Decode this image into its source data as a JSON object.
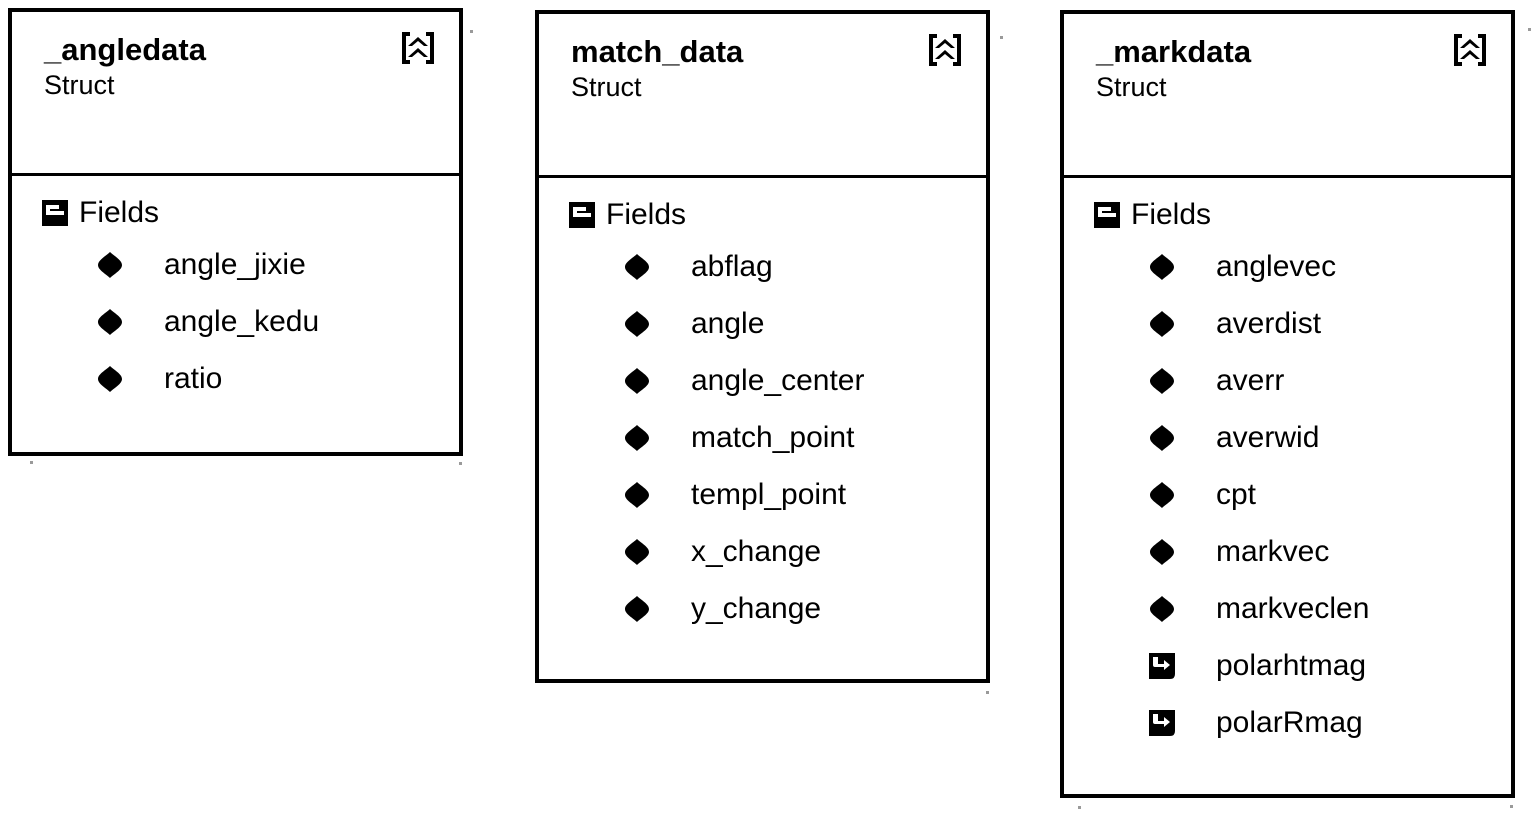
{
  "diagram": {
    "kind": "uml-struct-diagram",
    "background_color": "#ffffff",
    "line_color": "#000000",
    "cards": [
      {
        "title": "_angledata",
        "stereotype": "Struct",
        "collapse_icon": "double-chevron-up-icon",
        "group": {
          "label": "Fields",
          "icon": "fields-group-icon"
        },
        "fields": [
          {
            "name": "angle_jixie",
            "icon": "field-diamond-icon"
          },
          {
            "name": "angle_kedu",
            "icon": "field-diamond-icon"
          },
          {
            "name": "ratio",
            "icon": "field-diamond-icon"
          }
        ]
      },
      {
        "title": "match_data",
        "stereotype": "Struct",
        "collapse_icon": "double-chevron-up-icon",
        "group": {
          "label": "Fields",
          "icon": "fields-group-icon"
        },
        "fields": [
          {
            "name": "abflag",
            "icon": "field-diamond-icon"
          },
          {
            "name": "angle",
            "icon": "field-diamond-icon"
          },
          {
            "name": "angle_center",
            "icon": "field-diamond-icon"
          },
          {
            "name": "match_point",
            "icon": "field-diamond-icon"
          },
          {
            "name": "templ_point",
            "icon": "field-diamond-icon"
          },
          {
            "name": "x_change",
            "icon": "field-diamond-icon"
          },
          {
            "name": "y_change",
            "icon": "field-diamond-icon"
          }
        ]
      },
      {
        "title": "_markdata",
        "stereotype": "Struct",
        "collapse_icon": "double-chevron-up-icon",
        "group": {
          "label": "Fields",
          "icon": "fields-group-icon"
        },
        "fields": [
          {
            "name": "anglevec",
            "icon": "field-diamond-icon"
          },
          {
            "name": "averdist",
            "icon": "field-diamond-icon"
          },
          {
            "name": "averr",
            "icon": "field-diamond-icon"
          },
          {
            "name": "averwid",
            "icon": "field-diamond-icon"
          },
          {
            "name": "cpt",
            "icon": "field-diamond-icon"
          },
          {
            "name": "markvec",
            "icon": "field-diamond-icon"
          },
          {
            "name": "markveclen",
            "icon": "field-diamond-icon"
          },
          {
            "name": "polarhtmag",
            "icon": "property-square-icon"
          },
          {
            "name": "polarRmag",
            "icon": "property-square-icon"
          }
        ]
      }
    ]
  }
}
